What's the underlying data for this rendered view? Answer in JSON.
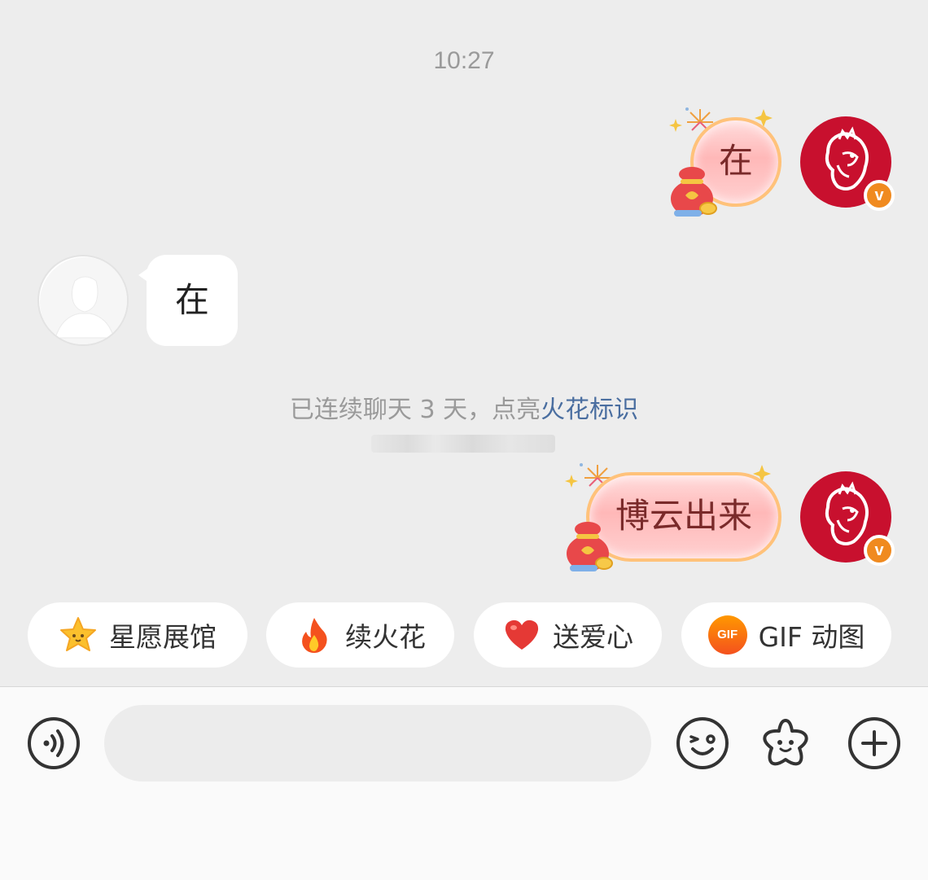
{
  "chat": {
    "timestamp": "10:27",
    "messages": [
      {
        "from": "me",
        "text": "在"
      },
      {
        "from": "other",
        "text": "在"
      },
      {
        "from": "me",
        "text": "博云出来"
      }
    ],
    "spark_notice": {
      "prefix": "已连续聊天 3 天，点亮",
      "link": "火花标识"
    },
    "me_badge": "v"
  },
  "quick_actions": [
    {
      "label": "星愿展馆",
      "icon": "star-icon"
    },
    {
      "label": "续火花",
      "icon": "flame-icon"
    },
    {
      "label": "送爱心",
      "icon": "heart-icon"
    },
    {
      "label": "GIF 动图",
      "icon": "gif-icon",
      "icon_text": "GIF"
    }
  ],
  "input_bar": {
    "placeholder": "",
    "buttons": [
      "voice-icon",
      "emoji-icon",
      "sticker-icon",
      "plus-icon"
    ]
  },
  "colors": {
    "background": "#ededed",
    "bubble_me_start": "#ffdcdc",
    "bubble_me_border": "#ffc27a",
    "avatar_me": "#c8102e",
    "badge": "#f08a1f",
    "link": "#4a6ea0"
  }
}
